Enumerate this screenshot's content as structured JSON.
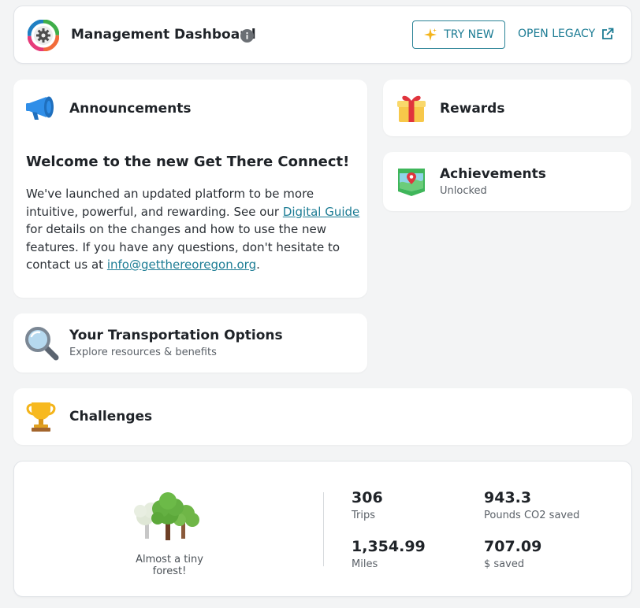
{
  "header": {
    "title": "Management Dashboard",
    "try_new_label": "TRY NEW",
    "open_legacy_label": "OPEN LEGACY"
  },
  "announcements": {
    "title": "Announcements",
    "headline": "Welcome to the new Get There Connect!",
    "body_part1": "We've launched an updated platform to be more intuitive, powerful, and rewarding. See our ",
    "link_guide": "Digital Guide",
    "body_part2": " for details on the changes and how to use the new features. If you have any questions, don't hesitate to contact us at ",
    "link_email": "info@getthereoregon.org",
    "body_part3": "."
  },
  "rewards": {
    "title": "Rewards"
  },
  "achievements": {
    "title": "Achievements",
    "subtitle": "Unlocked"
  },
  "transportation": {
    "title": "Your Transportation Options",
    "subtitle": "Explore resources & benefits"
  },
  "challenges": {
    "title": "Challenges"
  },
  "stats": {
    "forest_label": "Almost a tiny forest!",
    "items": [
      {
        "value": "306",
        "label": "Trips"
      },
      {
        "value": "943.3",
        "label": "Pounds CO2 saved"
      },
      {
        "value": "1,354.99",
        "label": "Miles"
      },
      {
        "value": "707.09",
        "label": "$ saved"
      }
    ]
  },
  "colors": {
    "accent": "#1c7c94",
    "background": "#f3f4f5"
  },
  "icons": [
    "gear-icon",
    "info-icon",
    "sparkle-icon",
    "external-link-icon",
    "megaphone-icon",
    "gift-icon",
    "map-icon",
    "magnifier-icon",
    "trophy-icon",
    "trees-icon"
  ]
}
